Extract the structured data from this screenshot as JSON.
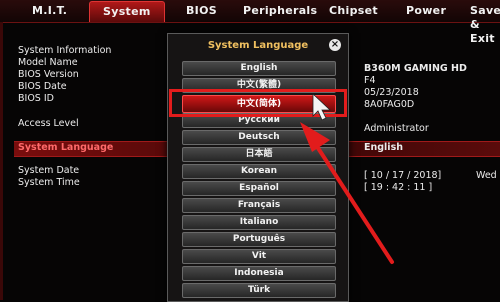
{
  "tabs": [
    {
      "label": "M.I.T.",
      "active": false
    },
    {
      "label": "System",
      "active": true
    },
    {
      "label": "BIOS",
      "active": false
    },
    {
      "label": "Peripherals",
      "active": false
    },
    {
      "label": "Chipset",
      "active": false
    },
    {
      "label": "Power",
      "active": false
    },
    {
      "label": "Save & Exit",
      "active": false
    }
  ],
  "system_info": {
    "section_label": "System Information",
    "model_name_label": "Model Name",
    "bios_version_label": "BIOS Version",
    "bios_date_label": "BIOS Date",
    "bios_id_label": "BIOS ID",
    "access_level_label": "Access Level",
    "system_language_label": "System Language",
    "system_date_label": "System Date",
    "system_time_label": "System Time",
    "model_name": "B360M GAMING HD",
    "bios_version": "F4",
    "bios_date": "05/23/2018",
    "bios_id": "8A0FAG0D",
    "access_level": "Administrator",
    "system_language": "English",
    "system_date": "[  10 / 17 / 2018]",
    "system_date_day": "Wed",
    "system_time": "[  19 : 42 : 11  ]"
  },
  "dialog": {
    "title": "System Language",
    "close_glyph": "×",
    "options": [
      "English",
      "中文(繁體)",
      "中文(简体)",
      "Русский",
      "Deutsch",
      "日本語",
      "Korean",
      "Español",
      "Français",
      "Italiano",
      "Português",
      "Vit",
      "Indonesia",
      "Türk"
    ],
    "highlighted": "中文(简体)"
  },
  "colors": {
    "accent": "#c01818",
    "annotation": "#e21c1c"
  }
}
